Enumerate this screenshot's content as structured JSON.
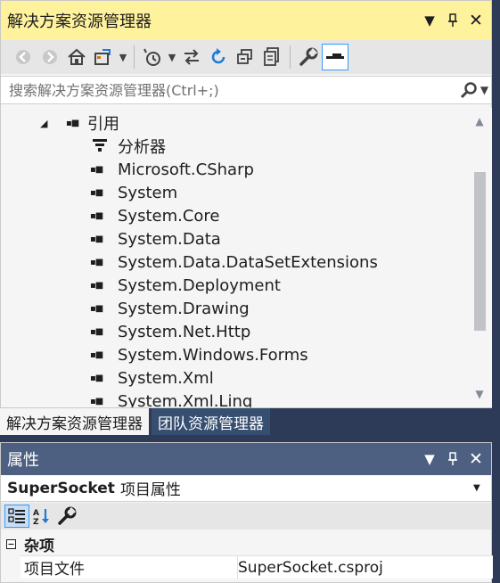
{
  "solution_explorer": {
    "title": "解决方案资源管理器",
    "title_buttons": {
      "dropdown": "▼",
      "pin": "📌",
      "close": "✕"
    },
    "search_placeholder": "搜索解决方案资源管理器(Ctrl+;)",
    "tree": {
      "references_label": "引用",
      "analyzers_label": "分析器",
      "items": [
        "Microsoft.CSharp",
        "System",
        "System.Core",
        "System.Data",
        "System.Data.DataSetExtensions",
        "System.Deployment",
        "System.Drawing",
        "System.Net.Http",
        "System.Windows.Forms",
        "System.Xml",
        "System.Xml.Linq"
      ]
    }
  },
  "tabs": {
    "active": "解决方案资源管理器",
    "inactive": "团队资源管理器"
  },
  "properties": {
    "title": "属性",
    "object_name": "SuperSocket",
    "object_kind": "项目属性",
    "category": "杂项",
    "rows": [
      {
        "name": "项目文件",
        "value": "SuperSocket.csproj"
      }
    ]
  },
  "icons": {
    "back": "back-icon",
    "forward": "forward-icon",
    "home": "home-icon",
    "switch_views": "switch-views-icon",
    "pending_changes": "pending-changes-filter-icon",
    "sync": "sync-with-active-document-icon",
    "refresh": "refresh-icon",
    "collapse_all": "collapse-all-icon",
    "show_all_files": "show-all-files-icon",
    "properties": "wrench-icon",
    "preview": "preview-selected-items-icon"
  },
  "colors": {
    "active_title": "#fff29d",
    "inactive_title": "#4d6082",
    "background": "#2d3b58",
    "accent": "#3399ff"
  }
}
